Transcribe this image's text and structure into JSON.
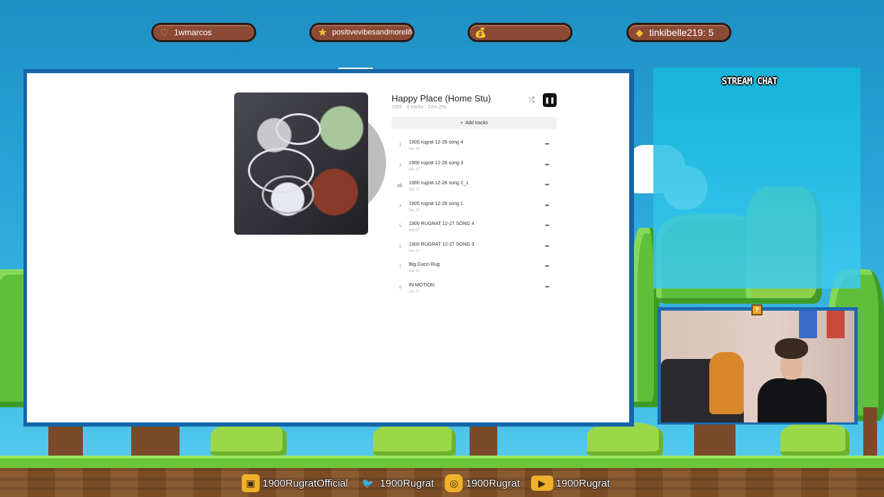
{
  "alerts": [
    {
      "icon": "heart-icon",
      "glyph": "♡",
      "text": "1wmarcos"
    },
    {
      "icon": "star-icon",
      "glyph": "★",
      "text": "positivevibesandmorelife"
    },
    {
      "icon": "money-bag-icon",
      "glyph": "💰",
      "text": ""
    },
    {
      "icon": "diamond-icon",
      "glyph": "◆",
      "text": "tinkibelle219: 5"
    }
  ],
  "player": {
    "title": "Happy Place (Home Stu)",
    "meta": "1900 · 8 tracks · 22m 25s",
    "shuffle_glyph": "⤮",
    "pause_glyph": "❚❚",
    "add_tracks": "Add tracks",
    "add_glyph": "+",
    "more_glyph": "•••",
    "playing_glyph": "ıılı",
    "tracks": [
      {
        "num": "1",
        "name": "1900 rugrat 12-28 song 4",
        "date": "Dec 27"
      },
      {
        "num": "2",
        "name": "1900 rugrat 12-28 song 3",
        "date": "Dec 27"
      },
      {
        "num": "",
        "name": "1900 rugrat 12-28 song 2_1",
        "date": "Dec 27"
      },
      {
        "num": "4",
        "name": "1900 rugrat 12-28 song 1",
        "date": "Dec 27"
      },
      {
        "num": "5",
        "name": "1900 RUGRAT 12-27 SONG 4",
        "date": "Dec 27"
      },
      {
        "num": "6",
        "name": "1900 RUGRAT 12-27 SONG 3",
        "date": "Dec 27"
      },
      {
        "num": "7",
        "name": "Big Gucci Rug",
        "date": "Dec 27"
      },
      {
        "num": "8",
        "name": "IN MOTION",
        "date": "Dec 27"
      }
    ]
  },
  "chat": {
    "title": "STREAM CHAT"
  },
  "webcam": {
    "qblock": "?"
  },
  "socials": [
    {
      "icon": "twitch-icon",
      "glyph": "▣",
      "color": "#f0b12a",
      "handle": "1900RugratOfficial"
    },
    {
      "icon": "twitter-icon",
      "glyph": "🐦",
      "color": "#f0b12a",
      "handle": "1900Rugrat"
    },
    {
      "icon": "instagram-icon",
      "glyph": "◎",
      "color": "#f0b12a",
      "handle": "1900Rugrat"
    },
    {
      "icon": "youtube-icon",
      "glyph": "▶",
      "color": "#f0b12a",
      "handle": "1900Rugrat"
    }
  ],
  "colors": {
    "sky": "#2aa6d8",
    "pill": "#8a4a36",
    "grass": "#6cc63a",
    "dirt": "#8a5a30"
  }
}
